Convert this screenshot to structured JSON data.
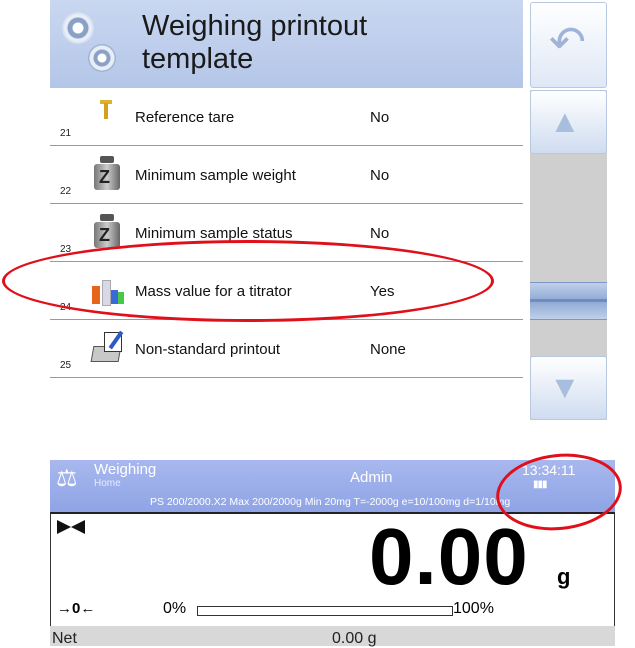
{
  "template_screen": {
    "title": "Weighing printout template",
    "back_icon": "undo-arrow-icon",
    "scroll": {
      "up_icon": "arrow-up-icon",
      "down_icon": "arrow-down-icon"
    },
    "rows": [
      {
        "num": "21",
        "label": "Reference tare",
        "value": "No",
        "icon": "tare-icon"
      },
      {
        "num": "22",
        "label": "Minimum sample weight",
        "value": "No",
        "icon": "weight-icon"
      },
      {
        "num": "23",
        "label": "Minimum sample status",
        "value": "No",
        "icon": "weight-icon"
      },
      {
        "num": "24",
        "label": "Mass value for a titrator",
        "value": "Yes",
        "icon": "titrator-icon"
      },
      {
        "num": "25",
        "label": "Non-standard printout",
        "value": "None",
        "icon": "printout-icon"
      }
    ]
  },
  "home_screen": {
    "mode": "Weighing",
    "sub": "Home",
    "user": "Admin",
    "time": "13:34:11",
    "params": "PS 200/2000.X2  Max 200/2000g  Min 20mg  T=-2000g  e=10/100mg  d=1/10mg",
    "reading": "0.00",
    "unit": "g",
    "zero_indicator": "→0←",
    "progress_min": "0%",
    "progress_max": "100%",
    "progress_fraction": 0,
    "net_label": "Net",
    "net_value": "0.00 g"
  },
  "colors": {
    "header": "#b4c6e8",
    "topbar": "#8fa4e6",
    "annotation": "#e0101a"
  }
}
